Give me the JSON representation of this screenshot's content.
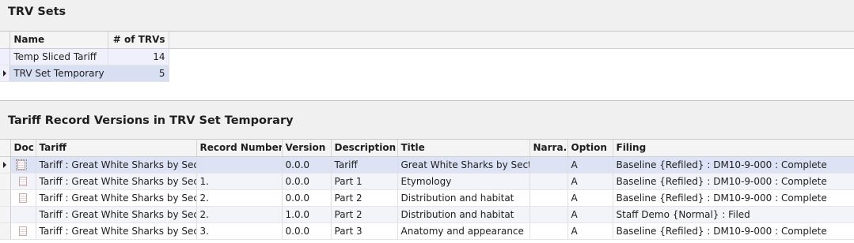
{
  "sets_section": {
    "title": "TRV Sets",
    "columns": [
      "Name",
      "# of TRVs"
    ],
    "rows": [
      {
        "name": "Temp Sliced Tariff",
        "count": "14"
      },
      {
        "name": "TRV Set Temporary",
        "count": "5"
      }
    ]
  },
  "records_section": {
    "title": "Tariff Record Versions in TRV Set Temporary",
    "columns": [
      "Doc",
      "Tariff",
      "Record Number",
      "Version",
      "Description",
      "Title",
      "Narra...",
      "Option",
      "Filing"
    ],
    "rows": [
      {
        "tariff": "Tariff : Great White Sharks by Section",
        "record": "",
        "version": "0.0.0",
        "description": "Tariff",
        "title": "Great White Sharks by Section",
        "narrative": "",
        "option": "A",
        "filing": "Baseline {Refiled} : DM10-9-000 : Complete",
        "doc_icon": "document-icon-focused"
      },
      {
        "tariff": "Tariff : Great White Sharks by Section",
        "record": "1.",
        "version": "0.0.0",
        "description": "Part 1",
        "title": "Etymology",
        "narrative": "",
        "option": "A",
        "filing": "Baseline {Refiled} : DM10-9-000 : Complete",
        "doc_icon": "document-icon"
      },
      {
        "tariff": "Tariff : Great White Sharks by Section",
        "record": "2.",
        "version": "0.0.0",
        "description": "Part 2",
        "title": "Distribution and habitat",
        "narrative": "",
        "option": "A",
        "filing": "Baseline {Refiled} : DM10-9-000 : Complete",
        "doc_icon": "document-icon"
      },
      {
        "tariff": "Tariff : Great White Sharks by Section",
        "record": "2.",
        "version": "1.0.0",
        "description": "Part 2",
        "title": "Distribution and habitat",
        "narrative": "",
        "option": "A",
        "filing": "Staff Demo {Normal} : Filed",
        "doc_icon": ""
      },
      {
        "tariff": "Tariff : Great White Sharks by Section",
        "record": "3.",
        "version": "0.0.0",
        "description": "Part 3",
        "title": "Anatomy and appearance",
        "narrative": "",
        "option": "A",
        "filing": "Baseline {Refiled} : DM10-9-000 : Complete",
        "doc_icon": "document-icon"
      }
    ]
  }
}
